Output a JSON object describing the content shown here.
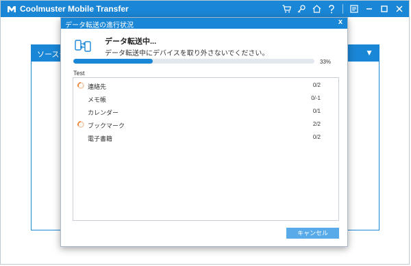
{
  "app": {
    "title": "Coolmuster Mobile Transfer",
    "accent": "#1a86d6",
    "toolbar_icons": [
      "cart-icon",
      "key-icon",
      "home-icon",
      "help-icon",
      "feedback-icon",
      "minimize-icon",
      "maximize-icon",
      "close-icon"
    ]
  },
  "background_panel": {
    "title": "ソースデ",
    "collapse_icon": "triangle-down-icon"
  },
  "dialog": {
    "title": "データ転送の進行状況",
    "close_label": "x",
    "header_title": "データ転送中...",
    "header_subtitle": "データ転送中にデバイスを取り外さないでください。",
    "progress_percent": 33,
    "progress_text": "33%",
    "list_label": "Test",
    "items": [
      {
        "name": "連絡先",
        "count": "0/2",
        "spinner": true
      },
      {
        "name": "メモ帳",
        "count": "0/-1",
        "spinner": false
      },
      {
        "name": "カレンダー",
        "count": "0/1",
        "spinner": false
      },
      {
        "name": "ブックマーク",
        "count": "2/2",
        "spinner": true
      },
      {
        "name": "電子書籍",
        "count": "0/2",
        "spinner": false
      }
    ],
    "cancel_label": "キャンセル"
  }
}
